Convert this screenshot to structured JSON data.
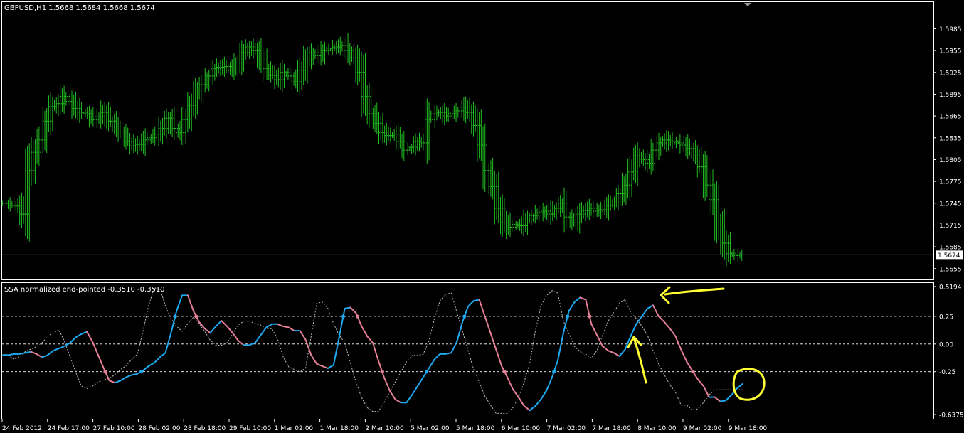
{
  "main_pane": {
    "header": "GBPUSD,H1  1.5668 1.5684 1.5668 1.5674",
    "price_ticks": [
      "1.5985",
      "1.5955",
      "1.5925",
      "1.5895",
      "1.5865",
      "1.5835",
      "1.5805",
      "1.5775",
      "1.5745",
      "1.5715",
      "1.5685",
      "1.5655"
    ],
    "current_price_label": "1.5674"
  },
  "indicator_pane": {
    "header": "SSA normalized end-pointed -0.3510 -0.3510",
    "ticks": [
      "0.5194",
      "0.25",
      "0.00",
      "-0.25",
      "-0.6375"
    ]
  },
  "time_axis": {
    "labels": [
      "24 Feb 2012",
      "24 Feb 17:00",
      "27 Feb 10:00",
      "28 Feb 02:00",
      "28 Feb 18:00",
      "29 Feb 10:00",
      "1 Mar 02:00",
      "1 Mar 18:00",
      "2 Mar 10:00",
      "5 Mar 02:00",
      "5 Mar 18:00",
      "6 Mar 10:00",
      "7 Mar 02:00",
      "7 Mar 18:00",
      "8 Mar 10:00",
      "9 Mar 02:00",
      "9 Mar 18:00"
    ]
  },
  "colors": {
    "bars": "#22c022",
    "ssa_up": "#1ea9f0",
    "ssa_down": "#e57f96",
    "dashed_line": "#bfbfbf",
    "grid": "#ffffff",
    "annotation": "#ffff33",
    "current_price_line": "#7f9cc4"
  },
  "chart_data": [
    {
      "type": "bar",
      "title": "GBPUSD,H1",
      "bar_style": "OHLC",
      "ylim": [
        1.5645,
        1.6005
      ],
      "close_series": [
        1.5745,
        1.5742,
        1.5741,
        1.573,
        1.579,
        1.5815,
        1.5832,
        1.5858,
        1.5878,
        1.5882,
        1.5892,
        1.5885,
        1.5875,
        1.587,
        1.5868,
        1.586,
        1.5864,
        1.587,
        1.5858,
        1.585,
        1.5843,
        1.583,
        1.5824,
        1.5826,
        1.5832,
        1.5835,
        1.584,
        1.5848,
        1.5862,
        1.5848,
        1.5842,
        1.586,
        1.588,
        1.5898,
        1.5908,
        1.592,
        1.593,
        1.5932,
        1.5933,
        1.5928,
        1.5938,
        1.5952,
        1.596,
        1.5955,
        1.5942,
        1.593,
        1.5921,
        1.5915,
        1.5925,
        1.592,
        1.5912,
        1.5928,
        1.5942,
        1.5952,
        1.5948,
        1.5955,
        1.5958,
        1.596,
        1.5962,
        1.5955,
        1.5945,
        1.5925,
        1.5892,
        1.5868,
        1.5855,
        1.5842,
        1.5838,
        1.584,
        1.583,
        1.5818,
        1.5822,
        1.583,
        1.5828,
        1.586,
        1.5868,
        1.587,
        1.5865,
        1.5868,
        1.5872,
        1.5877,
        1.587,
        1.5852,
        1.5825,
        1.579,
        1.5768,
        1.5738,
        1.5718,
        1.5712,
        1.5716,
        1.5714,
        1.5722,
        1.5728,
        1.5732,
        1.5734,
        1.573,
        1.5738,
        1.5745,
        1.5726,
        1.5718,
        1.573,
        1.5735,
        1.5738,
        1.5734,
        1.5736,
        1.5742,
        1.5748,
        1.5758,
        1.577,
        1.5788,
        1.581,
        1.5805,
        1.58,
        1.5818,
        1.5828,
        1.5832,
        1.583,
        1.5828,
        1.5825,
        1.582,
        1.581,
        1.5795,
        1.577,
        1.575,
        1.5715,
        1.569,
        1.5676,
        1.5673,
        1.5674
      ]
    },
    {
      "type": "line",
      "title": "SSA normalized end-pointed",
      "ylim": [
        -0.6375,
        0.5194
      ],
      "ssa_values": [
        -0.1,
        -0.1,
        -0.09,
        -0.09,
        -0.08,
        -0.07,
        -0.09,
        -0.12,
        -0.1,
        -0.06,
        -0.04,
        -0.02,
        0.01,
        0.06,
        0.09,
        0.11,
        0.02,
        -0.1,
        -0.22,
        -0.33,
        -0.35,
        -0.33,
        -0.3,
        -0.28,
        -0.27,
        -0.24,
        -0.2,
        -0.17,
        -0.12,
        -0.08,
        0.1,
        0.3,
        0.44,
        0.44,
        0.3,
        0.2,
        0.14,
        0.1,
        0.16,
        0.21,
        0.16,
        0.1,
        0.03,
        -0.01,
        -0.01,
        0.01,
        0.08,
        0.15,
        0.18,
        0.18,
        0.16,
        0.15,
        0.12,
        0.12,
        0.04,
        -0.1,
        -0.18,
        -0.2,
        -0.22,
        -0.19,
        0.06,
        0.32,
        0.33,
        0.28,
        0.16,
        0.07,
        0.01,
        -0.15,
        -0.3,
        -0.42,
        -0.5,
        -0.53,
        -0.53,
        -0.46,
        -0.38,
        -0.3,
        -0.22,
        -0.14,
        -0.09,
        -0.09,
        -0.08,
        0.02,
        0.2,
        0.34,
        0.39,
        0.4,
        0.25,
        0.1,
        -0.05,
        -0.2,
        -0.3,
        -0.41,
        -0.48,
        -0.56,
        -0.6,
        -0.56,
        -0.5,
        -0.42,
        -0.3,
        -0.15,
        0.1,
        0.3,
        0.38,
        0.42,
        0.4,
        0.18,
        0.08,
        -0.02,
        -0.06,
        -0.08,
        -0.11,
        -0.05,
        0.07,
        0.18,
        0.25,
        0.32,
        0.35,
        0.25,
        0.2,
        0.14,
        0.07,
        -0.05,
        -0.16,
        -0.24,
        -0.32,
        -0.38,
        -0.48,
        -0.48,
        -0.52,
        -0.51,
        -0.46,
        -0.4,
        -0.36
      ],
      "reference_levels": [
        0.25,
        0,
        -0.25
      ]
    }
  ]
}
